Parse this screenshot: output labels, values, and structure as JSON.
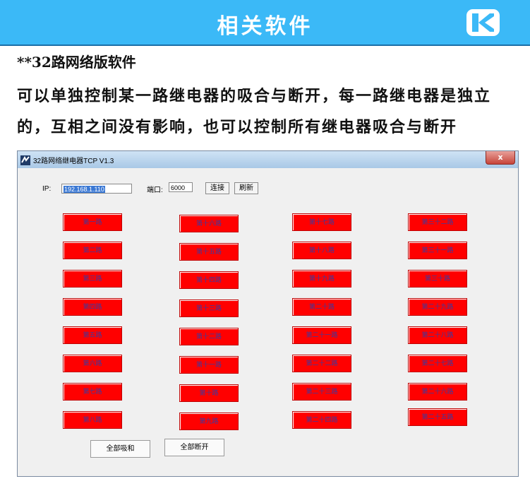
{
  "banner": {
    "title": "相关软件",
    "logo_letter": "K"
  },
  "intro": {
    "heading": "**32路网络版软件",
    "body": "可以单独控制某一路继电器的吸合与断开，每一路继电器是独立的，互相之间没有影响，也可以控制所有继电器吸合与断开"
  },
  "window": {
    "title": "32路网络继电器TCP V1.3",
    "close": "x",
    "ip_label": "IP:",
    "ip_value": "192.168.1.110",
    "port_label": "端口:",
    "port_value": "6000",
    "connect_label": "连接",
    "refresh_label": "刷新",
    "all_on_label": "全部吸和",
    "all_off_label": "全部断开"
  },
  "relays": [
    [
      "第一路",
      "第二路",
      "第三路",
      "第四路",
      "第五路",
      "第六路",
      "第七路",
      "第八路"
    ],
    [
      "第十六路",
      "第十五路",
      "第十四路",
      "第十三路",
      "第十二路",
      "第十一路",
      "第十路",
      "第九路"
    ],
    [
      "第十七路",
      "第十八路",
      "第十九路",
      "第二十路",
      "第二十一路",
      "第二十二路",
      "第二十三路",
      "第二十四路"
    ],
    [
      "第三十二路",
      "第三十一路",
      "第三十路",
      "第二十九路",
      "第二十八路",
      "第二十七路",
      "第二十六路",
      "第二十五路"
    ]
  ],
  "colors": {
    "banner": "#3bb9f7",
    "relay": "#ff0000",
    "relay_text": "#3a3aa0"
  }
}
